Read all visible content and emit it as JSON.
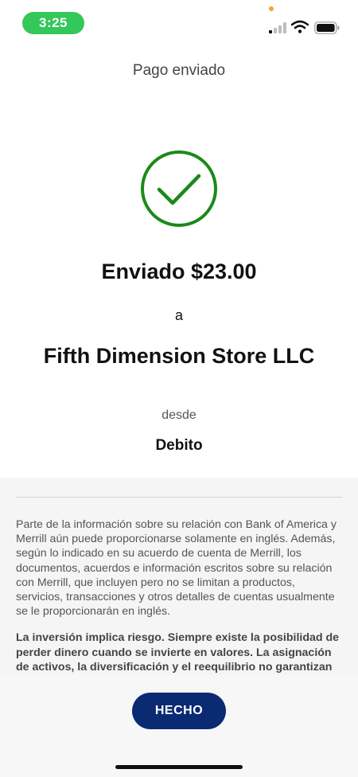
{
  "status_bar": {
    "time": "3:25",
    "icons": [
      "signal-icon",
      "wifi-icon",
      "battery-icon"
    ],
    "time_pill_color": "#34c759",
    "indicator_dot_color": "#f5a623"
  },
  "header": {
    "title": "Pago enviado"
  },
  "confirmation": {
    "icon": "check-circle-icon",
    "icon_color": "#1a8a1a",
    "amount_line": "Enviado $23.00",
    "to_word": "a",
    "recipient": "Fifth Dimension Store LLC",
    "from_word": "desde",
    "account": "Debito"
  },
  "disclosure": {
    "paragraph1": "Parte de la información sobre su relación con Bank of America y Merrill aún puede proporcionarse solamente en inglés. Además, según lo indicado en su acuerdo de cuenta de Merrill, los documentos, acuerdos e información escritos sobre su relación con Merrill, que incluyen pero no se limitan a productos, servicios, transacciones y otros detalles de cuentas usualmente se le proporcionarán en inglés.",
    "paragraph2": "La inversión implica riesgo. Siempre existe la posibilidad de perder dinero cuando se invierte en valores. La asignación de activos, la diversificación y el reequilibrio no garantizan una ganancia ni protegen contra pérdidas"
  },
  "footer": {
    "done_label": "HECHO",
    "button_color": "#0a2a72"
  }
}
